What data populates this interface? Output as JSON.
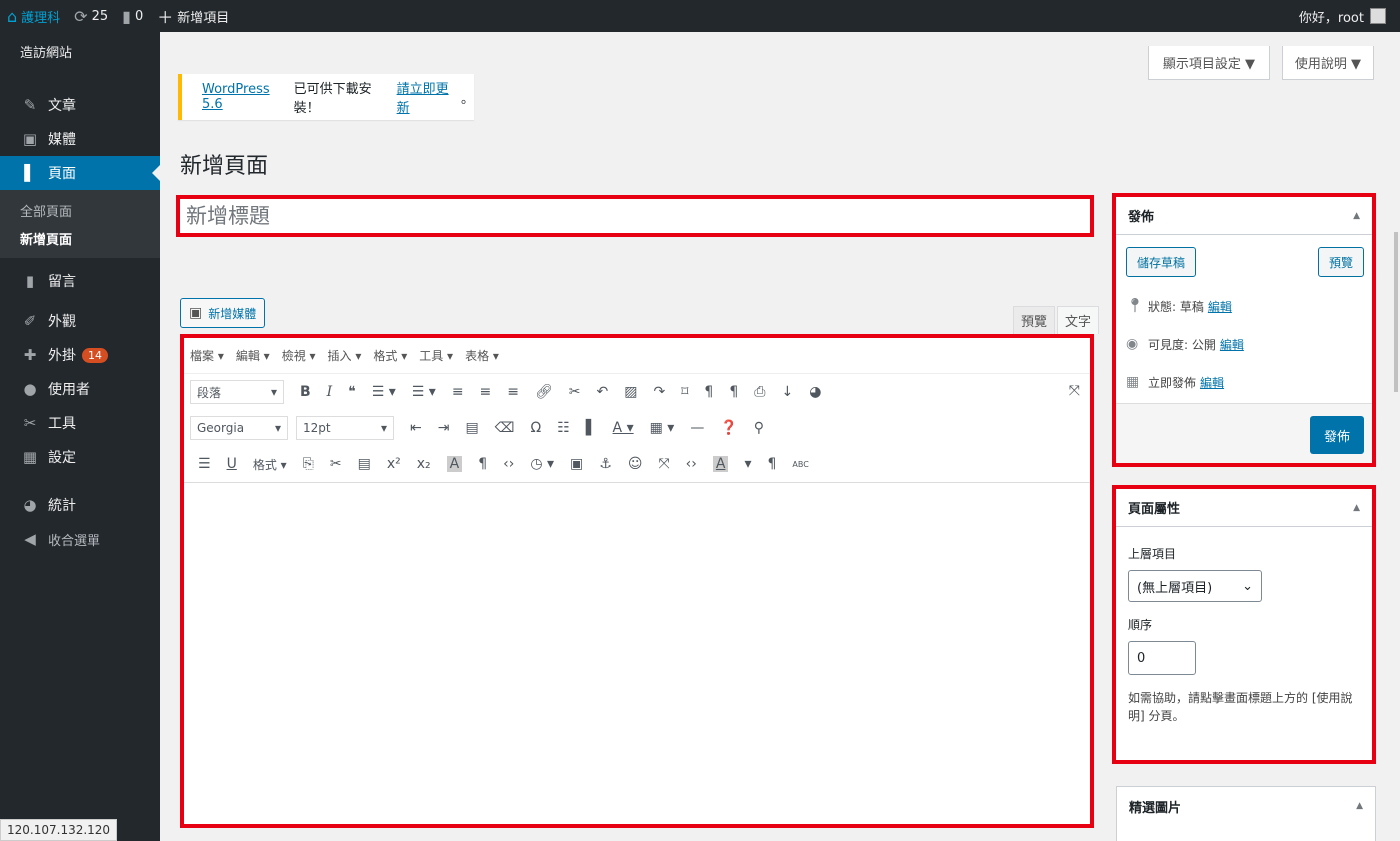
{
  "admin_bar": {
    "site_name": "護理科",
    "updates_count": "25",
    "comments_count": "0",
    "new_item_label": "新增項目",
    "greeting": "你好，root"
  },
  "sidebar": {
    "visit_site": "造訪網站",
    "items": [
      {
        "label": "文章",
        "icon": "pushpin-icon"
      },
      {
        "label": "媒體",
        "icon": "media-icon"
      },
      {
        "label": "頁面",
        "icon": "page-icon"
      },
      {
        "label": "留言",
        "icon": "comment-icon"
      },
      {
        "label": "外觀",
        "icon": "appearance-icon"
      },
      {
        "label": "外掛",
        "icon": "plugin-icon",
        "badge": "14"
      },
      {
        "label": "使用者",
        "icon": "user-icon"
      },
      {
        "label": "工具",
        "icon": "tools-icon"
      },
      {
        "label": "設定",
        "icon": "settings-icon"
      },
      {
        "label": "統計",
        "icon": "stats-icon"
      },
      {
        "label": "收合選單",
        "icon": "collapse-icon"
      }
    ],
    "submenu": [
      "全部頁面",
      "新增頁面"
    ],
    "ip_address": "120.107.132.120"
  },
  "screen_meta": {
    "screen_options": "顯示項目設定 ▼",
    "help": "使用說明 ▼"
  },
  "notice": {
    "version_link": "WordPress 5.6",
    "middle_text": " 已可供下載安裝！",
    "update_link": "請立即更新",
    "end_text": "。"
  },
  "page": {
    "title": "新增頁面",
    "title_placeholder": "新增標題"
  },
  "editor": {
    "add_media_label": "新增媒體",
    "tab_visual": "預覽",
    "tab_text": "文字",
    "menubar": [
      "檔案 ▾",
      "編輯 ▾",
      "檢視 ▾",
      "插入 ▾",
      "格式 ▾",
      "工具 ▾",
      "表格 ▾"
    ],
    "format_select": "段落",
    "font_select": "Georgia",
    "size_select": "12pt",
    "format_menu": "格式 ▾",
    "abc_label": "ABC"
  },
  "publish_box": {
    "title": "發佈",
    "save_draft": "儲存草稿",
    "preview": "預覽",
    "status_label": "狀態: 草稿",
    "visibility_label": "可見度: 公開",
    "schedule_label": "立即發佈",
    "edit_link": "編輯",
    "publish_button": "發佈"
  },
  "attributes_box": {
    "title": "頁面屬性",
    "parent_label": "上層項目",
    "parent_value": "(無上層項目)",
    "order_label": "順序",
    "order_value": "0",
    "help_text": "如需協助，請點擊畫面標題上方的 [使用說明] 分頁。"
  },
  "featured_box": {
    "title": "精選圖片"
  },
  "colors": {
    "accent": "#0073aa",
    "highlight": "#e60012",
    "admin_dark": "#23282d"
  }
}
